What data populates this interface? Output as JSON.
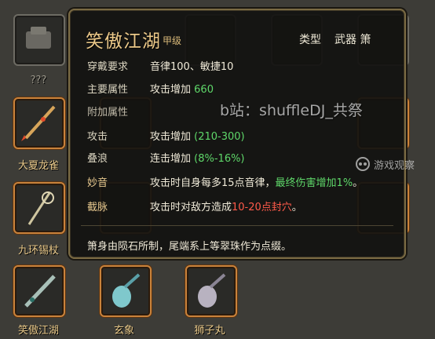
{
  "grid": {
    "unknown_label": "???",
    "items": [
      {
        "label": "大夏龙雀"
      },
      {
        "label": "九环锡杖"
      },
      {
        "label": "笑傲江湖"
      },
      {
        "label": "玄象"
      },
      {
        "label": "狮子丸"
      }
    ]
  },
  "tooltip": {
    "title": "笑傲江湖",
    "grade": "甲级",
    "type_label": "类型",
    "type_value": "武器 箫",
    "requirements": {
      "label": "穿戴要求",
      "value": "音律100、敏捷10"
    },
    "main_attr": {
      "label": "主要属性",
      "value_prefix": "攻击增加",
      "value_num": "660"
    },
    "extra_header": "附加属性",
    "attrs": [
      {
        "label": "攻击",
        "prefix": "攻击增加",
        "value": "(210-300)"
      },
      {
        "label": "叠浪",
        "prefix": "连击增加",
        "value": "(8%-16%)"
      }
    ],
    "skills": [
      {
        "label": "妙音",
        "text": "攻击时自身每多15点音律，",
        "highlight": "最终伤害增加1%",
        "suffix": "。"
      },
      {
        "label": "截脉",
        "text": "攻击时对敌方造成",
        "highlight": "10-20点封穴",
        "suffix": "。"
      }
    ],
    "description": "箫身由陨石所制，尾端系上等翠珠作为点缀。"
  },
  "watermark": "b站：shuffleDJ_共祭",
  "site_badge": "游戏观察"
}
